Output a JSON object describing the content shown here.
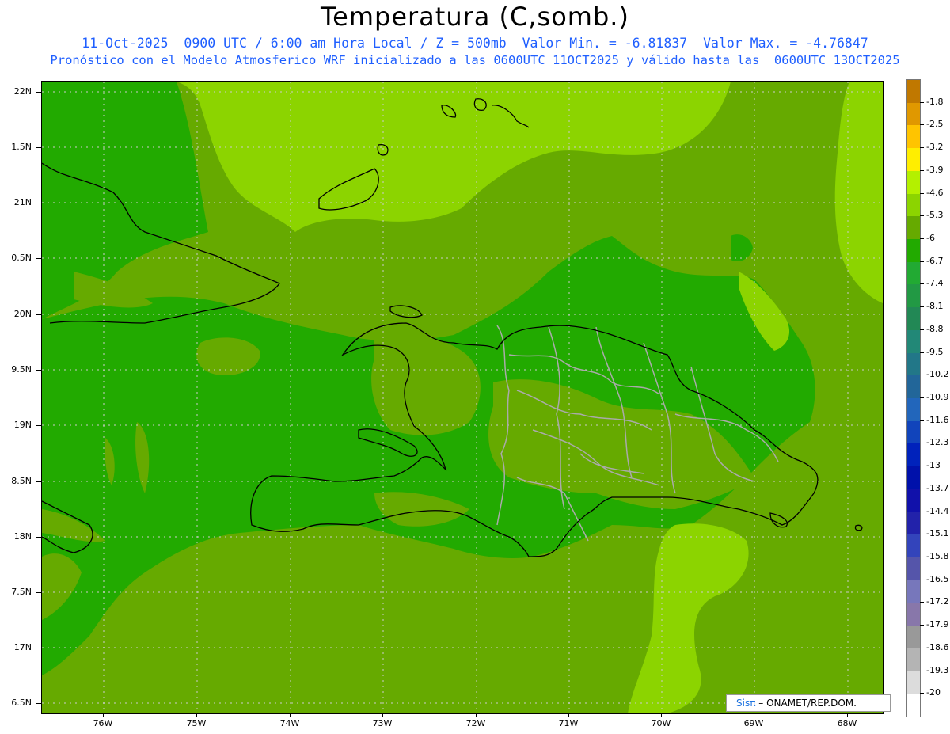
{
  "header": {
    "title": "Temperatura (C,somb.)",
    "subtitle_line1": "11-Oct-2025  0900 UTC / 6:00 am Hora Local / Z = 500mb  Valor Min. = -6.81837  Valor Max. = -4.76847",
    "subtitle_line2": "Pronóstico con el Modelo Atmosferico WRF inicializado a las 0600UTC_11OCT2025 y válido hasta las  0600UTC_13OCT2025"
  },
  "axes": {
    "lat_labels": [
      "22N",
      "1.5N",
      "21N",
      "0.5N",
      "20N",
      "9.5N",
      "19N",
      "8.5N",
      "18N",
      "7.5N",
      "17N",
      "6.5N"
    ],
    "lon_labels": [
      "76W",
      "75W",
      "74W",
      "73W",
      "72W",
      "71W",
      "70W",
      "69W",
      "68W"
    ]
  },
  "colorbar": {
    "labels": [
      "-1.8",
      "-2.5",
      "-3.2",
      "-3.9",
      "-4.6",
      "-5.3",
      "-6",
      "-6.7",
      "-7.4",
      "-8.1",
      "-8.8",
      "-9.5",
      "-10.2",
      "-10.9",
      "-11.6",
      "-12.3",
      "-13",
      "-13.7",
      "-14.4",
      "-15.1",
      "-15.8",
      "-16.5",
      "-17.2",
      "-17.9",
      "-18.6",
      "-19.3",
      "-20"
    ],
    "colors": [
      "#c07800",
      "#e09800",
      "#ffc400",
      "#ffee00",
      "#b4f000",
      "#8cd400",
      "#66aa00",
      "#22aa00",
      "#22aa33",
      "#229944",
      "#228855",
      "#228877",
      "#227788",
      "#226699",
      "#2266bb",
      "#1144bb",
      "#0022bb",
      "#0011aa",
      "#1111aa",
      "#2222aa",
      "#3344bb",
      "#5555aa",
      "#7777bb",
      "#8877aa",
      "#999999",
      "#b4b4b4",
      "#dcdcdc",
      "#ffffff"
    ]
  },
  "map": {
    "legend_colors": {
      "light": "#8cd400",
      "mid": "#66aa00",
      "dark": "#22aa00",
      "coast": "#000000",
      "provinces": "#aaaaaa",
      "grid": "#cccccc"
    }
  },
  "credit": {
    "logo_text": "Sisπ",
    "agency": "– ONAMET/REP.DOM."
  }
}
